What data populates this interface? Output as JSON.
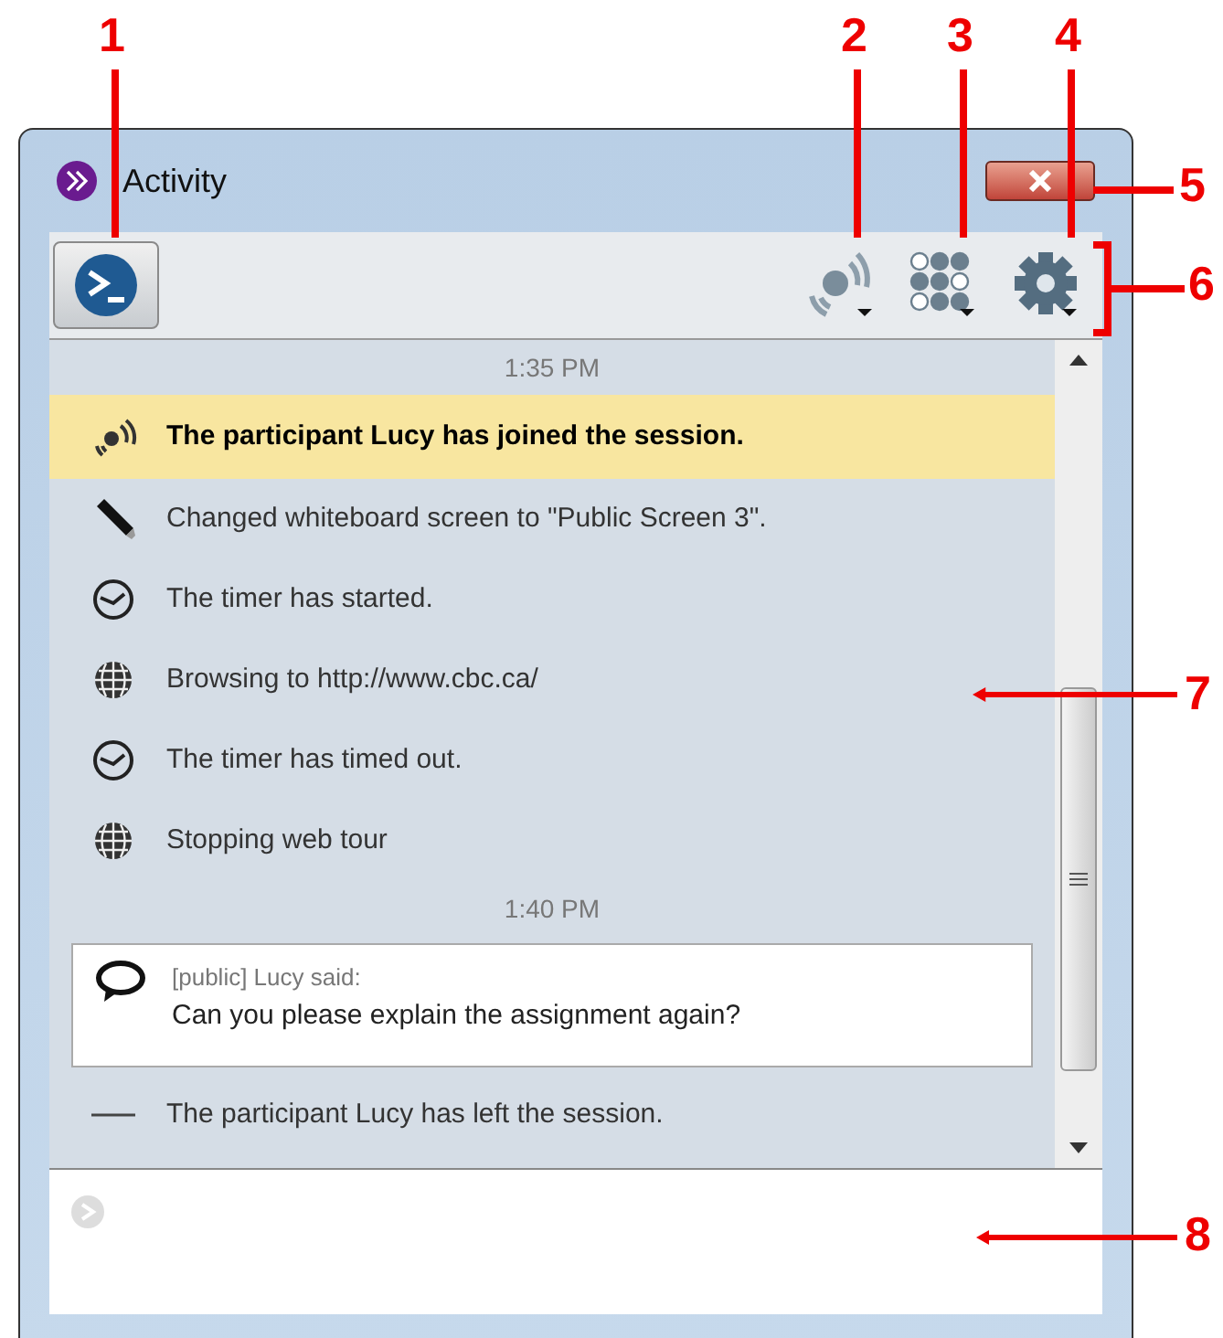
{
  "window": {
    "title": "Activity"
  },
  "toolbar": {
    "left_button": {
      "kind": "console"
    },
    "right_buttons": [
      {
        "kind": "signal"
      },
      {
        "kind": "grid"
      },
      {
        "kind": "gear"
      }
    ]
  },
  "log": [
    {
      "kind": "time",
      "text": "1:35 PM"
    },
    {
      "kind": "join",
      "highlighted": true,
      "text": "The participant Lucy has joined the session."
    },
    {
      "kind": "whiteboard",
      "highlighted": false,
      "text": "Changed whiteboard screen to \"Public Screen 3\"."
    },
    {
      "kind": "timer",
      "highlighted": false,
      "text": "The timer has started."
    },
    {
      "kind": "web",
      "highlighted": false,
      "text": "Browsing to http://www.cbc.ca/"
    },
    {
      "kind": "timer",
      "highlighted": false,
      "text": "The timer has timed out."
    },
    {
      "kind": "web",
      "highlighted": false,
      "text": "Stopping web tour"
    },
    {
      "kind": "time",
      "text": "1:40 PM"
    },
    {
      "kind": "chat",
      "sender": "[public] Lucy said:",
      "text": "Can you please explain the assignment again?"
    },
    {
      "kind": "leave",
      "highlighted": false,
      "text": "The participant Lucy has left the session."
    }
  ],
  "callouts": [
    "1",
    "2",
    "3",
    "4",
    "5",
    "6",
    "7",
    "8"
  ]
}
